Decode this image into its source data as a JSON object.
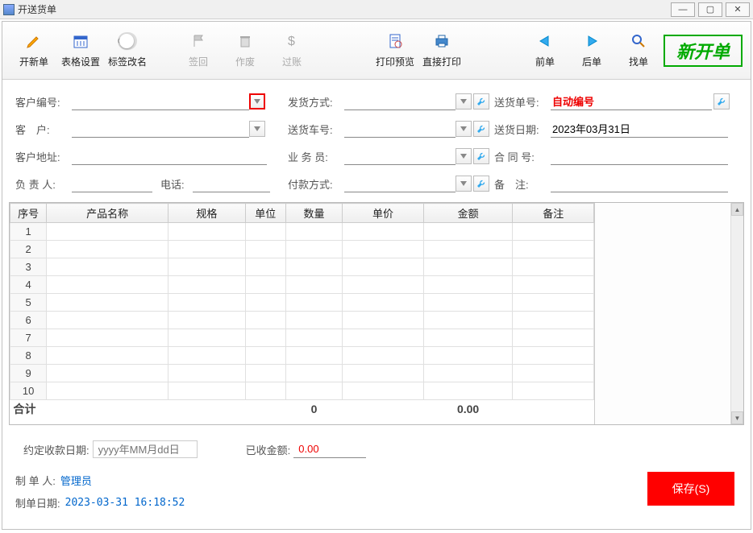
{
  "window": {
    "title": "开送货单"
  },
  "toolbar": {
    "new_order": "开新单",
    "table_settings": "表格设置",
    "label_rename": "标签改名",
    "toggle_text": "OFF",
    "sign_back": "签回",
    "void": "作废",
    "post": "过账",
    "print_preview": "打印预览",
    "direct_print": "直接打印",
    "prev": "前单",
    "next": "后单",
    "find": "找单",
    "badge": "新开单"
  },
  "form": {
    "customer_code_label": "客户编号:",
    "customer_code": "",
    "customer_label": "客　户:",
    "customer": "",
    "address_label": "客户地址:",
    "address": "",
    "manager_label": "负 责 人:",
    "manager": "",
    "phone_label": "电话:",
    "phone": "",
    "ship_method_label": "发货方式:",
    "ship_method": "",
    "vehicle_label": "送货车号:",
    "vehicle": "",
    "salesman_label": "业 务 员:",
    "salesman": "",
    "pay_method_label": "付款方式:",
    "pay_method": "",
    "order_no_label": "送货单号:",
    "order_no": "自动编号",
    "ship_date_label": "送货日期:",
    "ship_date": "2023年03月31日",
    "contract_label": "合 同 号:",
    "contract": "",
    "remark_label": "备　注:",
    "remark": ""
  },
  "grid": {
    "headers": [
      "序号",
      "产品名称",
      "规格",
      "单位",
      "数量",
      "单价",
      "金额",
      "备注"
    ],
    "rows": [
      "1",
      "2",
      "3",
      "4",
      "5",
      "6",
      "7",
      "8",
      "9",
      "10"
    ],
    "total_label": "合计",
    "total_qty": "0",
    "total_amount": "0.00"
  },
  "footer": {
    "due_date_label": "约定收款日期:",
    "due_date_placeholder": "yyyy年MM月dd日",
    "received_label": "已收金额:",
    "received": "0.00",
    "creator_label": "制 单 人:",
    "creator": "管理员",
    "create_date_label": "制单日期:",
    "create_date": "2023-03-31 16:18:52",
    "save_btn": "保存(S)"
  }
}
